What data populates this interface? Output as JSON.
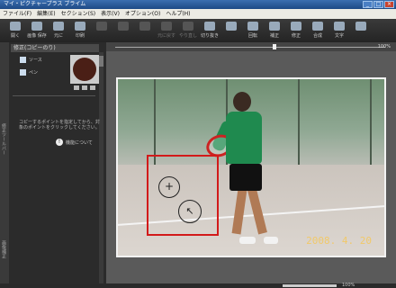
{
  "window": {
    "title": "マイ・ピクチャープラス ブライム",
    "buttons": [
      "_",
      "□",
      "×"
    ]
  },
  "menu": [
    "ファイル(F)",
    "編集(E)",
    "セクション(S)",
    "表示(V)",
    "オプション(O)",
    "ヘルプ(H)"
  ],
  "toolbar": [
    {
      "label": "開く",
      "icon": "folder-icon",
      "enabled": true
    },
    {
      "label": "画像 保存",
      "icon": "save-icon",
      "enabled": true
    },
    {
      "label": "元に",
      "icon": "undo-icon",
      "enabled": true
    },
    {
      "label": "印刷",
      "icon": "print-icon",
      "enabled": true
    },
    {
      "label": "",
      "icon": "tool-icon",
      "enabled": false
    },
    {
      "label": "",
      "icon": "tool-icon",
      "enabled": false
    },
    {
      "label": "",
      "icon": "tool-icon",
      "enabled": false
    },
    {
      "label": "元に戻す",
      "icon": "undo-icon",
      "enabled": false
    },
    {
      "label": "やり直し",
      "icon": "redo-icon",
      "enabled": false
    },
    {
      "label": "切り抜き",
      "icon": "crop-icon",
      "enabled": true
    },
    {
      "label": "",
      "icon": "tool-icon",
      "enabled": true
    },
    {
      "label": "回転",
      "icon": "rotate-icon",
      "enabled": true
    },
    {
      "label": "補正",
      "icon": "adjust-icon",
      "enabled": true
    },
    {
      "label": "修正",
      "icon": "retouch-icon",
      "enabled": true
    },
    {
      "label": "合成",
      "icon": "merge-icon",
      "enabled": true
    },
    {
      "label": "文字",
      "icon": "text-icon",
      "enabled": true
    },
    {
      "label": "",
      "icon": "tool-icon",
      "enabled": true
    }
  ],
  "panel": {
    "title": "修正(コピーのり)",
    "brush_rows": [
      {
        "label": "ソース"
      },
      {
        "label": "ペン"
      }
    ],
    "description": "コピーするポイントを指定してから、対象のポイントをクリックしてください。",
    "info_label": "機能について",
    "side_tab_label": "修正ツールバー",
    "side_tab_label2": "画像補正"
  },
  "canvas": {
    "zoom_text": "100%",
    "date_stamp": "2008. 4. 20",
    "source_marker": "+",
    "target_marker": "↖"
  },
  "statusbar": {
    "zoom_text": "100%"
  },
  "colors": {
    "highlight_box": "#d21a1a",
    "brush_color": "#4a1f16",
    "date_stamp": "#f1c96a"
  }
}
